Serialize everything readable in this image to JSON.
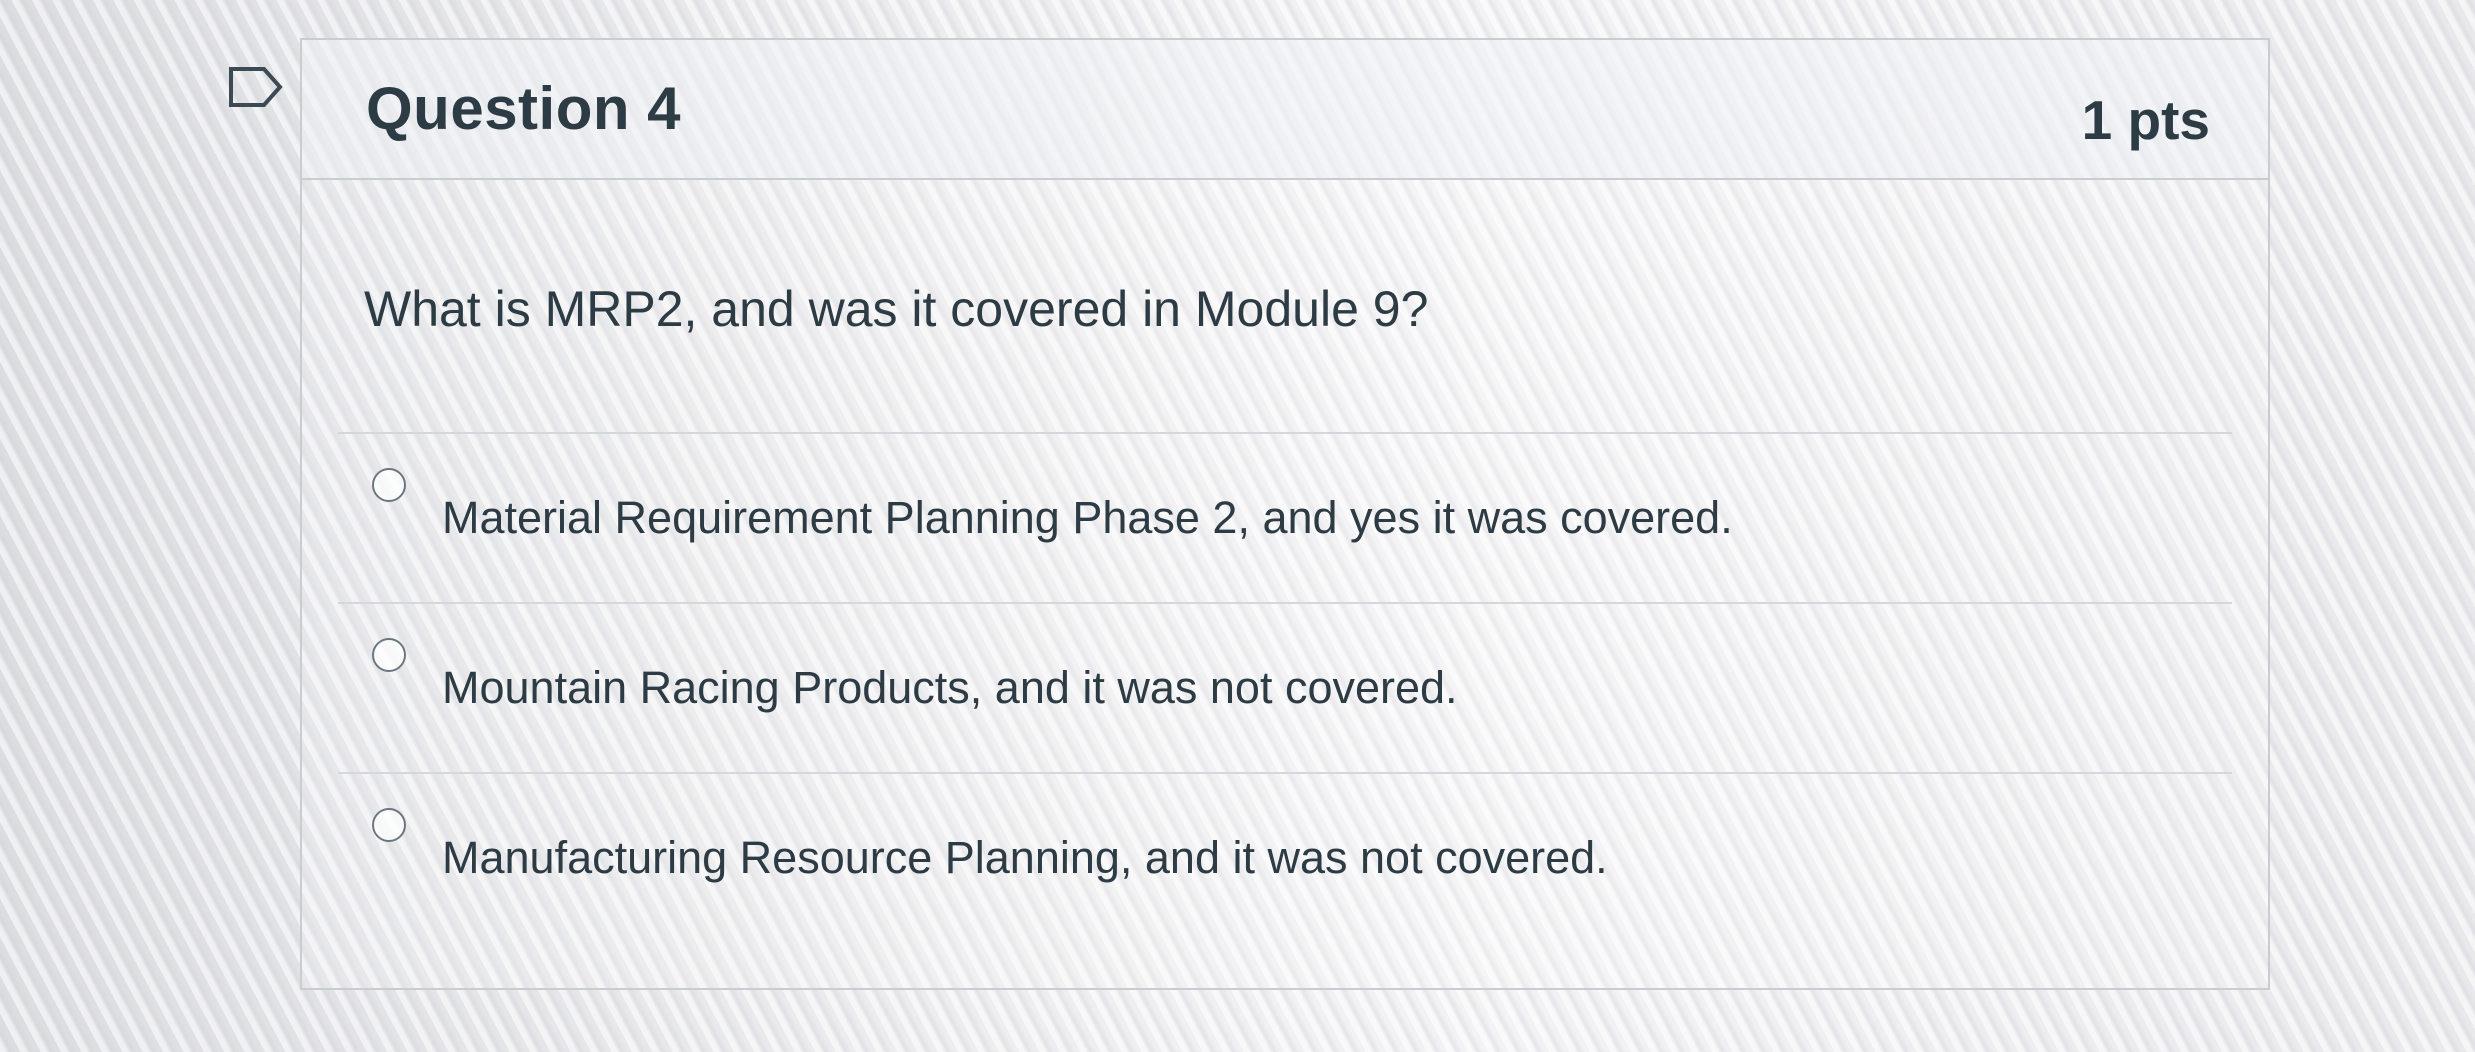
{
  "question": {
    "title": "Question 4",
    "points": "1 pts",
    "text": "What is MRP2, and was it covered in Module 9?"
  },
  "answers": [
    {
      "label": "Material Requirement Planning Phase 2, and yes it was covered.",
      "selected": false
    },
    {
      "label": "Mountain Racing Products, and it was not covered.",
      "selected": false
    },
    {
      "label": "Manufacturing Resource Planning, and it was not covered.",
      "selected": false
    }
  ],
  "icons": {
    "flag": "flag-question-icon",
    "radio": "radio-unchecked-icon"
  },
  "colors": {
    "text": "#2d3b45",
    "border": "#c7cdd1"
  }
}
